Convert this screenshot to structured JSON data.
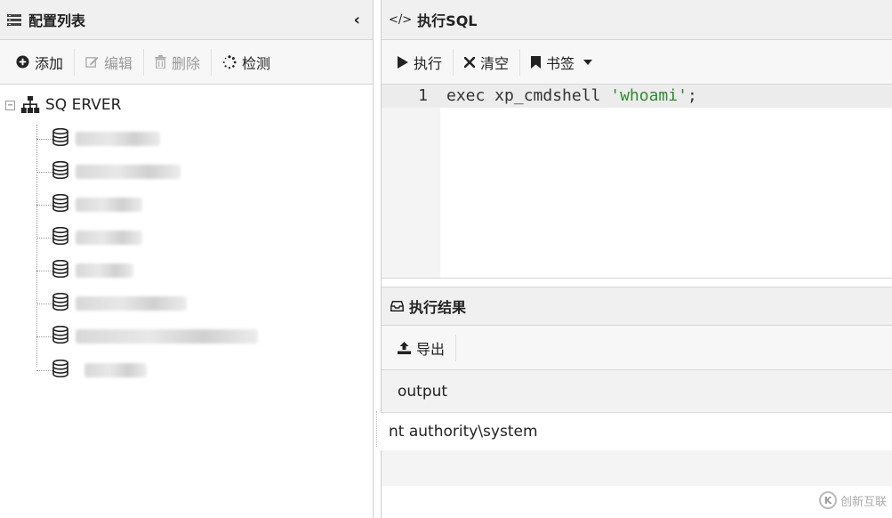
{
  "left_panel": {
    "title": "配置列表",
    "collapse_glyph": "‹",
    "toolbar": {
      "add": "添加",
      "edit": "编辑",
      "delete": "删除",
      "detect": "检测"
    },
    "tree": {
      "expander": "−",
      "root_label": "SQ  ERVER",
      "items": [
        {
          "label": ""
        },
        {
          "label": ""
        },
        {
          "label": ""
        },
        {
          "label": ""
        },
        {
          "label": ""
        },
        {
          "label": ""
        },
        {
          "label": ""
        },
        {
          "label": ""
        }
      ]
    }
  },
  "sql_panel": {
    "title": "执行SQL",
    "title_icon": "</>",
    "toolbar": {
      "run": "执行",
      "clear": "清空",
      "bookmark": "书签"
    },
    "editor": {
      "line_number": "1",
      "code_prefix": "exec xp_cmdshell ",
      "code_string": "'whoami'",
      "code_suffix": ";"
    }
  },
  "result_panel": {
    "title": "执行结果",
    "toolbar": {
      "export": "导出"
    },
    "columns": [
      "output"
    ],
    "rows": [
      [
        "nt authority\\system"
      ]
    ]
  },
  "watermark": {
    "text": "创新互联",
    "mark": "K"
  }
}
